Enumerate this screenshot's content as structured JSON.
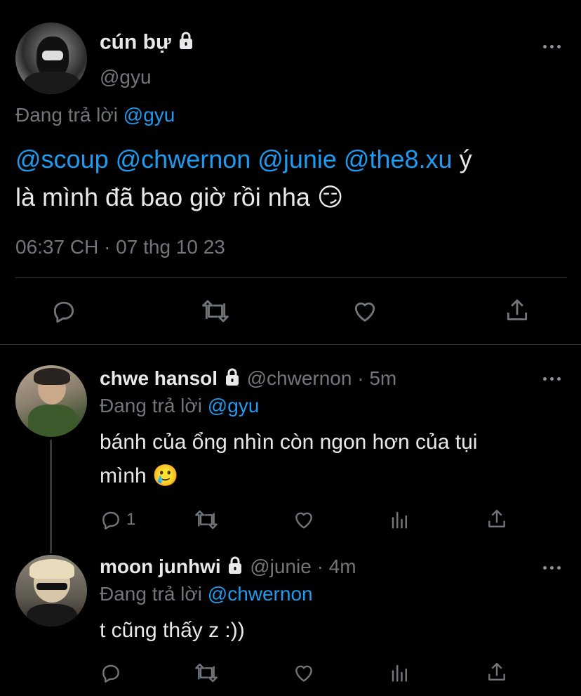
{
  "main_tweet": {
    "display_name": "cún bự",
    "handle": "@gyu",
    "replying_prefix": "Đang trả lời",
    "replying_to": "@gyu",
    "mentions": [
      "@scoup",
      "@chwernon",
      "@junie",
      "@the8.xu"
    ],
    "text_after_mentions": "ý",
    "text_line2": "là mình đã bao giờ rồi nha",
    "emoji": "😏",
    "timestamp": "06:37 CH · 07 thg 10 23"
  },
  "replies": [
    {
      "display_name": "chwe hansol",
      "handle": "@chwernon",
      "age": "· 5m",
      "replying_prefix": "Đang trả lời",
      "replying_to": "@gyu",
      "text_line1": "bánh của ổng nhìn còn ngon hơn của tụi",
      "text_line2": "mình",
      "emoji": "🥲",
      "reply_count": "1"
    },
    {
      "display_name": "moon junhwi",
      "handle": "@junie",
      "age": "· 4m",
      "replying_prefix": "Đang trả lời",
      "replying_to": "@chwernon",
      "text_line1": "t cũng thấy z :))",
      "reply_count": ""
    }
  ],
  "colors": {
    "background": "#000000",
    "text": "#e7e9ea",
    "muted": "#71767b",
    "link": "#1d9bf0"
  },
  "icons": [
    "lock-icon",
    "more-icon",
    "reply-icon",
    "retweet-icon",
    "like-icon",
    "share-icon",
    "views-icon"
  ]
}
